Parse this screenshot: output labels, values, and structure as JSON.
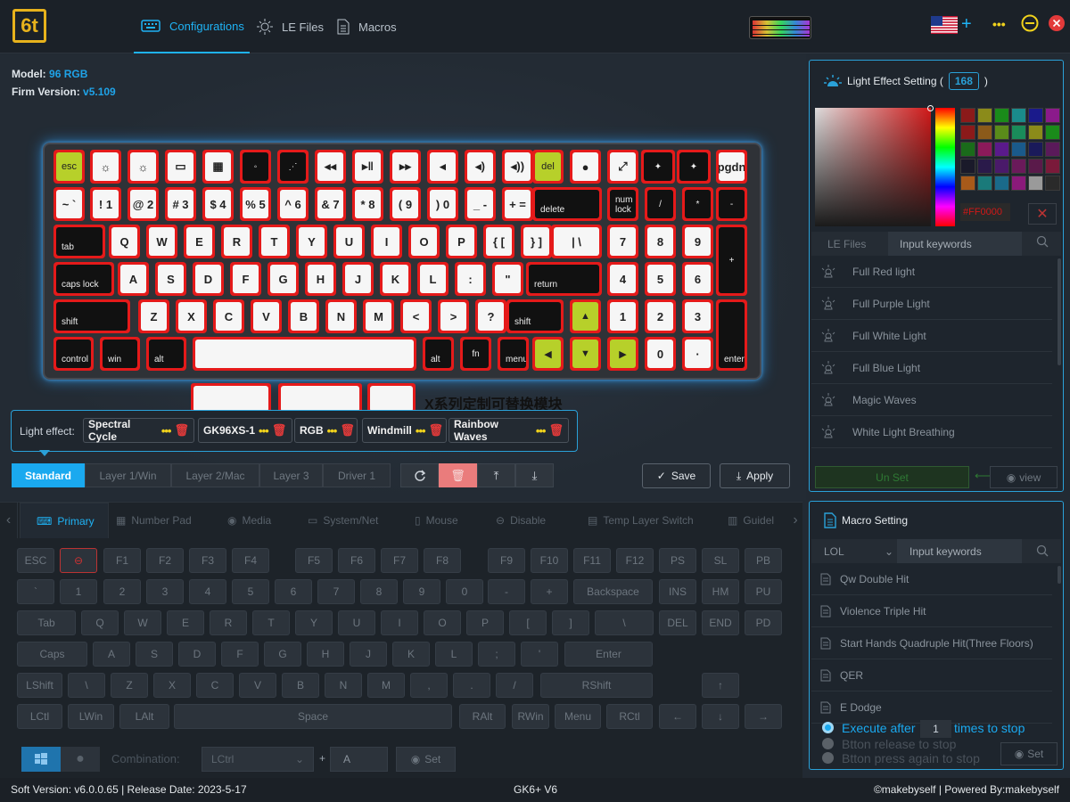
{
  "app": {
    "logo_text": "6t",
    "device_name": "GK6+ V6"
  },
  "nav": {
    "tabs": [
      {
        "label": "Configurations",
        "icon": "keyboard-icon",
        "active": true
      },
      {
        "label": "LE Files",
        "icon": "sun-icon",
        "active": false
      },
      {
        "label": "Macros",
        "icon": "document-icon",
        "active": false
      }
    ],
    "add_symbol": "+",
    "more_symbol": "•••"
  },
  "device": {
    "model_label": "Model:",
    "model": "96 RGB",
    "firm_label": "Firm Version:",
    "firm": "v5.109"
  },
  "module_note": "X系列定制可替换模块",
  "light_effect": {
    "label": "Light effect:",
    "chips": [
      "Spectral Cycle",
      "GK96XS-1",
      "RGB",
      "Windmill",
      "Rainbow Waves"
    ]
  },
  "layers": [
    "Standard",
    "Layer 1/Win",
    "Layer 2/Mac",
    "Layer 3",
    "Driver 1"
  ],
  "actions": {
    "save": "Save",
    "apply": "Apply"
  },
  "function_tabs": [
    "Primary",
    "Number Pad",
    "Media",
    "System/Net",
    "Mouse",
    "Disable",
    "Temp Layer Switch",
    "Guidel"
  ],
  "bottom_keys": {
    "r1": [
      "ESC",
      "F1",
      "F2",
      "F3",
      "F4",
      "F5",
      "F6",
      "F7",
      "F8",
      "F9",
      "F10",
      "F11",
      "F12",
      "PS",
      "SL",
      "PB"
    ],
    "r2": [
      "`",
      "1",
      "2",
      "3",
      "4",
      "5",
      "6",
      "7",
      "8",
      "9",
      "0",
      "-",
      "+",
      "Backspace",
      "INS",
      "HM",
      "PU"
    ],
    "r3": [
      "Tab",
      "Q",
      "W",
      "E",
      "R",
      "T",
      "Y",
      "U",
      "I",
      "O",
      "P",
      "[",
      "]",
      "\\",
      "DEL",
      "END",
      "PD"
    ],
    "r4": [
      "Caps",
      "A",
      "S",
      "D",
      "F",
      "G",
      "H",
      "J",
      "K",
      "L",
      ";",
      "'",
      "Enter"
    ],
    "r5": [
      "LShift",
      "\\",
      "Z",
      "X",
      "C",
      "V",
      "B",
      "N",
      "M",
      ",",
      ".",
      "/",
      "RShift",
      "↑"
    ],
    "r6": [
      "LCtl",
      "LWin",
      "LAlt",
      "Space",
      "RAlt",
      "RWin",
      "Menu",
      "RCtl",
      "←",
      "↓",
      "→"
    ]
  },
  "combination": {
    "label": "Combination:",
    "modifier": "LCtrl",
    "plus": "+",
    "key": "A",
    "set": "Set"
  },
  "light_setting": {
    "title": "Light Effect Setting (",
    "count": "168",
    "close_paren": ")",
    "hex": "#FF0000",
    "tab_files": "LE Files",
    "search_placeholder": "Input keywords",
    "items": [
      "Full Red light",
      "Full Purple Light",
      "Full White Light",
      "Full Blue Light",
      "Magic Waves",
      "White Light Breathing"
    ],
    "unset": "Un Set",
    "view": "view",
    "palette": [
      "#8b1a1a",
      "#8b8b1a",
      "#1a8b1a",
      "#1a8b8b",
      "#1a1a8b",
      "#8b1a8b",
      "#8b1a1a",
      "#8b5a1a",
      "#5a8b1a",
      "#1a8b5a",
      "#8b8b1a",
      "#1a8b1a",
      "#1a6b1a",
      "#8b1a5a",
      "#5a1a8b",
      "#1a5a8b",
      "#1a1a5a",
      "#5a1a5a",
      "#1a1a2a",
      "#2a1a4a",
      "#4a1a6a",
      "#6a1a5a",
      "#5a1a4a",
      "#7a1a3a",
      "#a85a1a",
      "#1a7a7a",
      "#1a6a8a",
      "#8a1a7a",
      "#9a9a9a",
      "#2a2a2a"
    ]
  },
  "macro": {
    "title": "Macro Setting",
    "dropdown": "LOL",
    "search_placeholder": "Input keywords",
    "items": [
      "Qw Double Hit",
      "Violence Triple Hit",
      "Start Hands Quadruple Hit(Three Floors)",
      "QER",
      "E Dodge"
    ],
    "exec_prefix": "Execute after",
    "exec_value": "1",
    "exec_suffix": "times to stop",
    "opt2": "Btton release to stop",
    "opt3": "Btton press again to stop",
    "set": "Set"
  },
  "status": {
    "left": "Soft Version: v6.0.0.65 | Release Date: 2023-5-17",
    "right": "©makebyself | Powered By:makebyself"
  }
}
